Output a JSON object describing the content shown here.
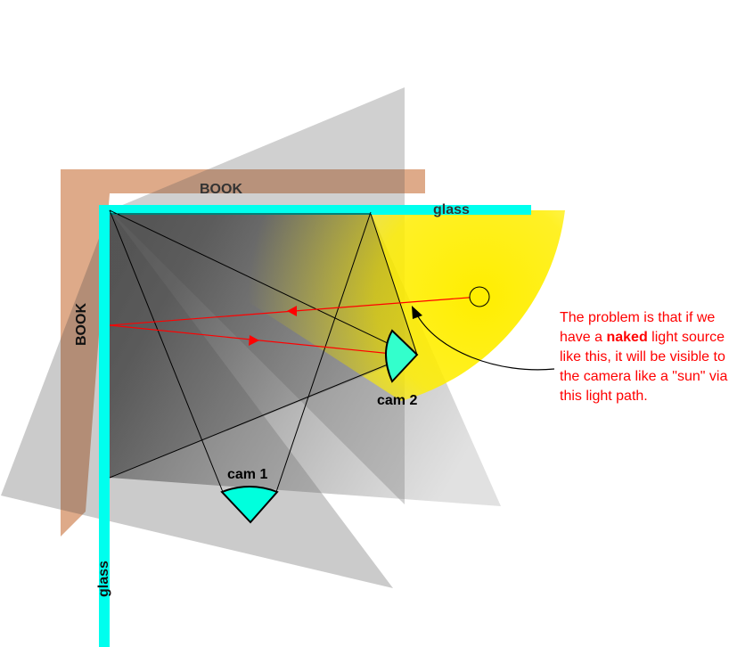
{
  "labels": {
    "book_top": "BOOK",
    "book_left": "BOOK",
    "glass_top": "glass",
    "glass_left": "glass",
    "cam1": "cam 1",
    "cam2": "cam 2"
  },
  "annotation": {
    "before": "The problem is that if we have a ",
    "emphasis": "naked",
    "after": " light source like this, it will be visible to the camera like a \"sun\" via this light path."
  },
  "colors": {
    "book": "#c8713a",
    "glass": "#00ffee",
    "light": "#ffee00",
    "ray": "#ff0000",
    "note_text": "#ff0000",
    "camera": "#00ffdd"
  }
}
